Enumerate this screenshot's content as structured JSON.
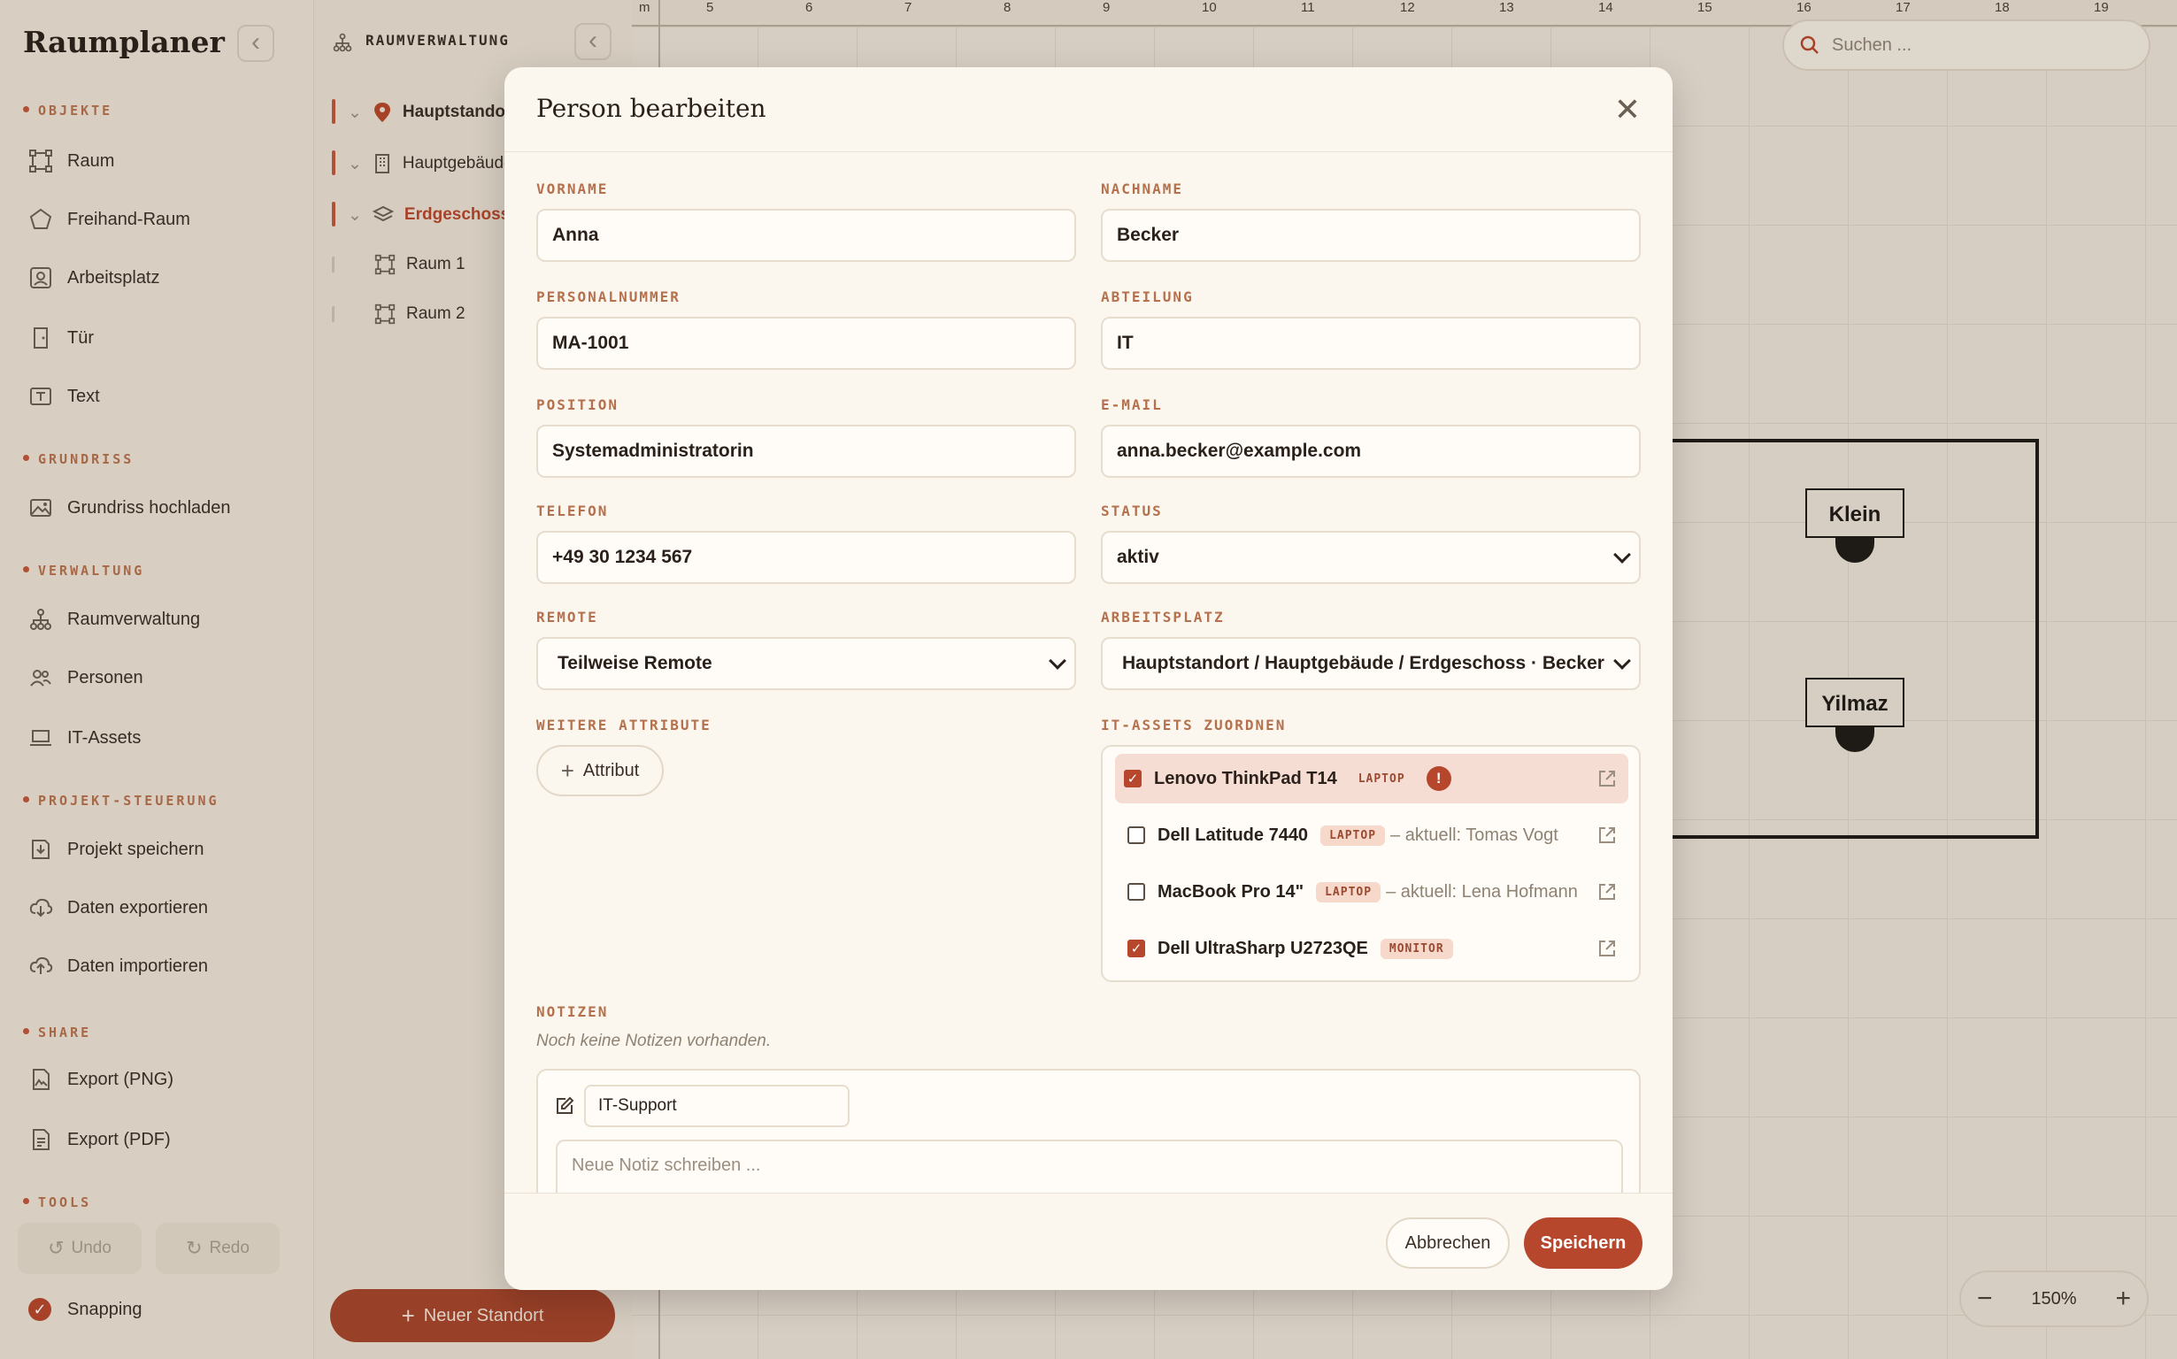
{
  "app": {
    "title": "Raumplaner"
  },
  "sidebar": {
    "sections": [
      {
        "label": "OBJEKTE",
        "items": [
          "Raum",
          "Freihand-Raum",
          "Arbeitsplatz",
          "Tür",
          "Text"
        ]
      },
      {
        "label": "GRUNDRISS",
        "items": [
          "Grundriss hochladen"
        ]
      },
      {
        "label": "VERWALTUNG",
        "items": [
          "Raumverwaltung",
          "Personen",
          "IT-Assets"
        ]
      },
      {
        "label": "PROJEKT-STEUERUNG",
        "items": [
          "Projekt speichern",
          "Daten exportieren",
          "Daten importieren"
        ]
      },
      {
        "label": "SHARE",
        "items": [
          "Export (PNG)",
          "Export (PDF)"
        ]
      },
      {
        "label": "TOOLS",
        "items": []
      }
    ],
    "tools": {
      "undo": "Undo",
      "redo": "Redo",
      "snapping": "Snapping"
    }
  },
  "tree": {
    "title": "RAUMVERWALTUNG",
    "nodes": [
      "Hauptstandort",
      "Hauptgebäude",
      "Erdgeschoss",
      "Raum 1",
      "Raum 2"
    ],
    "new_location": "Neuer Standort"
  },
  "canvas": {
    "unit": "m",
    "ticks": [
      "5",
      "6",
      "7",
      "8",
      "9",
      "10",
      "11",
      "12",
      "13",
      "14",
      "15",
      "16",
      "17",
      "18",
      "19"
    ],
    "search_placeholder": "Suchen ...",
    "desks": [
      "Klein",
      "Yilmaz"
    ],
    "zoom": "150%"
  },
  "modal": {
    "title": "Person bearbeiten",
    "fields": {
      "vorname": {
        "label": "VORNAME",
        "value": "Anna"
      },
      "nachname": {
        "label": "NACHNAME",
        "value": "Becker"
      },
      "personalnummer": {
        "label": "PERSONALNUMMER",
        "value": "MA-1001"
      },
      "abteilung": {
        "label": "ABTEILUNG",
        "value": "IT"
      },
      "position": {
        "label": "POSITION",
        "value": "Systemadministratorin"
      },
      "email": {
        "label": "E-MAIL",
        "value": "anna.becker@example.com"
      },
      "telefon": {
        "label": "TELEFON",
        "value": "+49 30 1234 567"
      },
      "status": {
        "label": "STATUS",
        "value": "aktiv"
      },
      "remote": {
        "label": "REMOTE",
        "value": "Teilweise Remote"
      },
      "arbeitsplatz": {
        "label": "ARBEITSPLATZ",
        "value": "Hauptstandort / Hauptgebäude / Erdgeschoss · Becker"
      }
    },
    "weitere_label": "WEITERE ATTRIBUTE",
    "attribut_button": "Attribut",
    "assets_label": "IT-ASSETS ZUORDNEN",
    "assets": [
      {
        "name": "Lenovo ThinkPad T14",
        "tag": "LAPTOP",
        "checked": true,
        "note": "",
        "warning": "!"
      },
      {
        "name": "Dell Latitude 7440",
        "tag": "LAPTOP",
        "checked": false,
        "note": "– aktuell: Tomas Vogt",
        "warning": ""
      },
      {
        "name": "MacBook Pro 14\"",
        "tag": "LAPTOP",
        "checked": false,
        "note": "– aktuell: Lena Hofmann",
        "warning": ""
      },
      {
        "name": "Dell UltraSharp U2723QE",
        "tag": "MONITOR",
        "checked": true,
        "note": "",
        "warning": ""
      }
    ],
    "notes_label": "NOTIZEN",
    "notes_empty": "Noch keine Notizen vorhanden.",
    "note_author": "IT-Support",
    "note_placeholder": "Neue Notiz schreiben ...",
    "cancel": "Abbrechen",
    "save": "Speichern"
  }
}
